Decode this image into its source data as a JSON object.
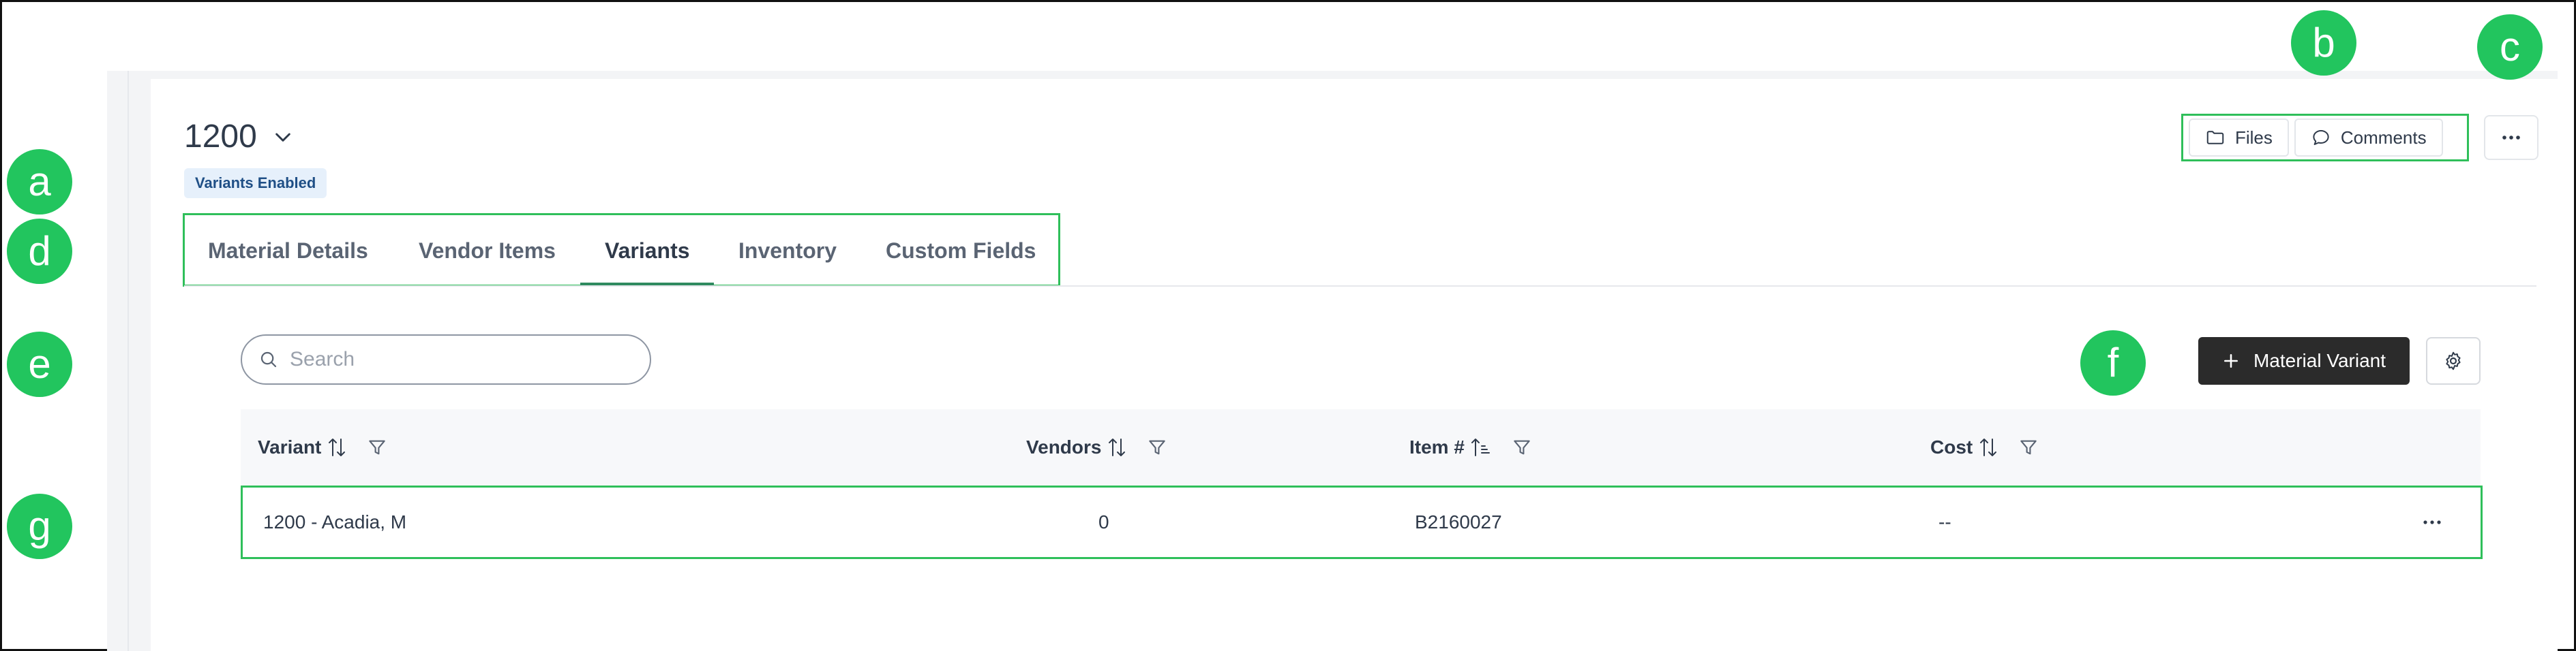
{
  "header": {
    "title": "1200",
    "badge": "Variants Enabled"
  },
  "toolbar": {
    "files_label": "Files",
    "comments_label": "Comments"
  },
  "tabs": [
    {
      "label": "Material Details"
    },
    {
      "label": "Vendor Items"
    },
    {
      "label": "Variants",
      "active": true
    },
    {
      "label": "Inventory"
    },
    {
      "label": "Custom Fields"
    }
  ],
  "search": {
    "placeholder": "Search",
    "value": ""
  },
  "actions": {
    "add_variant_label": "Material Variant"
  },
  "table": {
    "columns": [
      {
        "label": "Variant"
      },
      {
        "label": "Vendors"
      },
      {
        "label": "Item #"
      },
      {
        "label": "Cost"
      }
    ],
    "rows": [
      {
        "variant": "1200 - Acadia, M",
        "vendors": "0",
        "item": "B2160027",
        "cost": "--"
      }
    ]
  },
  "annotations": [
    "a",
    "b",
    "c",
    "d",
    "e",
    "f",
    "g"
  ],
  "colors": {
    "accent_green": "#22c55e",
    "tab_underline": "#2f8a5f",
    "badge_bg": "#e6f0fb",
    "badge_text": "#1f4f86",
    "primary_button": "#2b2b2b"
  }
}
